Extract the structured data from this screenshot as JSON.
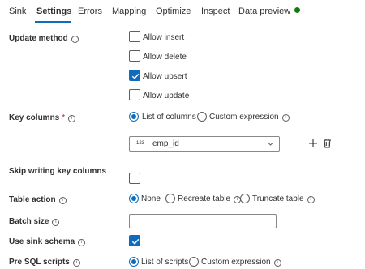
{
  "tabs": [
    {
      "label": "Sink",
      "active": false
    },
    {
      "label": "Settings",
      "active": true
    },
    {
      "label": "Errors",
      "active": false
    },
    {
      "label": "Mapping",
      "active": false
    },
    {
      "label": "Optimize",
      "active": false
    },
    {
      "label": "Inspect",
      "active": false
    },
    {
      "label": "Data preview",
      "active": false,
      "status_color": "#107c10"
    }
  ],
  "accent_color": "#0f6cbd",
  "update_method": {
    "label": "Update method",
    "options": [
      {
        "label": "Allow insert",
        "checked": false
      },
      {
        "label": "Allow delete",
        "checked": false
      },
      {
        "label": "Allow upsert",
        "checked": true
      },
      {
        "label": "Allow update",
        "checked": false
      }
    ]
  },
  "key_columns": {
    "label": "Key columns",
    "required_mark": "*",
    "options": [
      {
        "label": "List of columns",
        "selected": true
      },
      {
        "label": "Custom expression",
        "selected": false
      }
    ],
    "column": {
      "type_badge": "123",
      "value": "emp_id"
    }
  },
  "skip_writing": {
    "label": "Skip writing key columns",
    "checked": false
  },
  "table_action": {
    "label": "Table action",
    "options": [
      {
        "label": "None",
        "selected": true
      },
      {
        "label": "Recreate table",
        "selected": false
      },
      {
        "label": "Truncate table",
        "selected": false
      }
    ]
  },
  "batch_size": {
    "label": "Batch size",
    "value": ""
  },
  "use_sink_schema": {
    "label": "Use sink schema",
    "checked": true
  },
  "pre_sql": {
    "label": "Pre SQL scripts",
    "options": [
      {
        "label": "List of scripts",
        "selected": true
      },
      {
        "label": "Custom expression",
        "selected": false
      }
    ]
  },
  "icons": {
    "info": "info-icon",
    "add": "add-icon",
    "delete": "trash-icon",
    "dropdown": "chevron-down-icon",
    "check": "checkmark-icon"
  }
}
